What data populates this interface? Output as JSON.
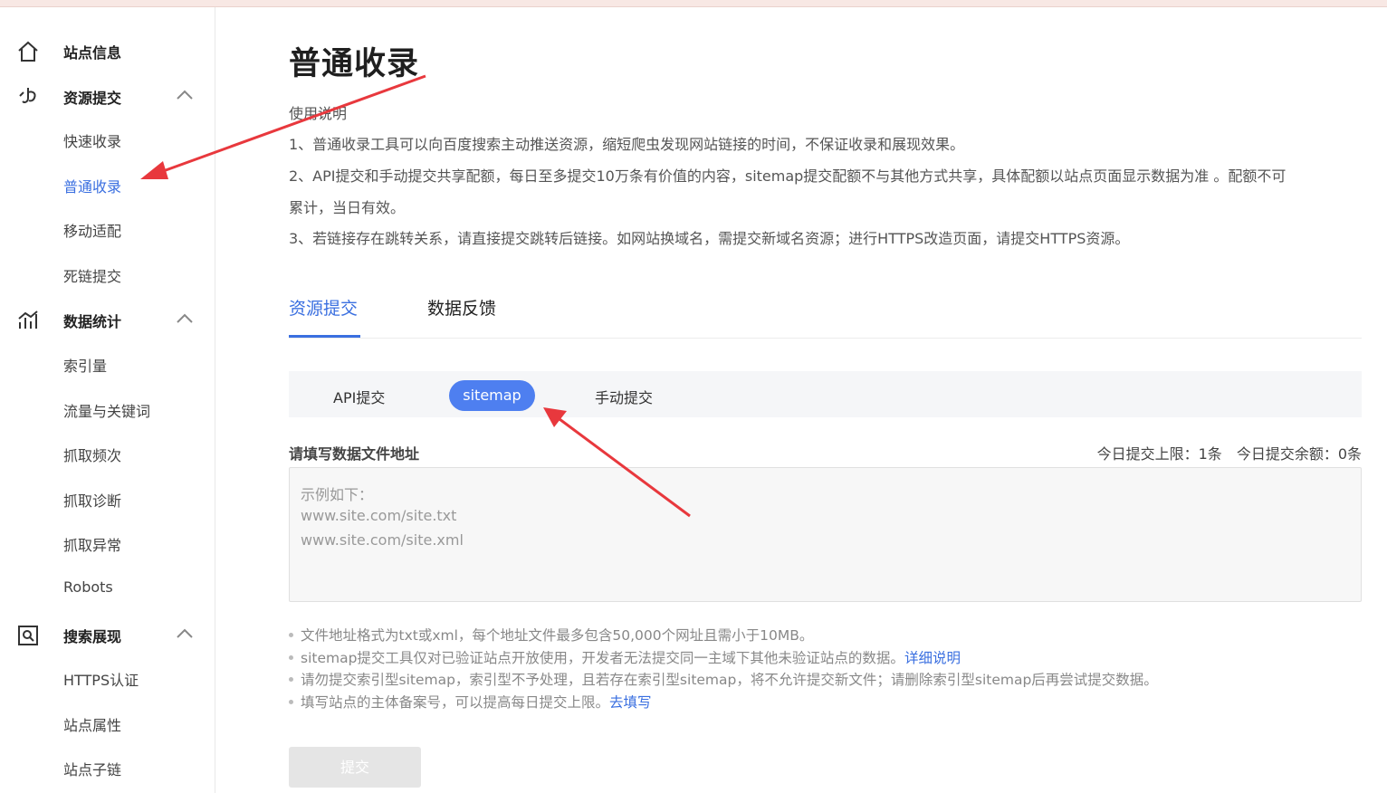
{
  "sidebar": {
    "groups": [
      {
        "label": "站点信息",
        "icon": "home-icon"
      },
      {
        "label": "资源提交",
        "icon": "submit-resource-icon",
        "items": [
          "快速收录",
          "普通收录",
          "移动适配",
          "死链提交"
        ]
      },
      {
        "label": "数据统计",
        "icon": "chart-icon",
        "items": [
          "索引量",
          "流量与关键词",
          "抓取频次",
          "抓取诊断",
          "抓取异常",
          "Robots"
        ]
      },
      {
        "label": "搜索展现",
        "icon": "search-display-icon",
        "items": [
          "HTTPS认证",
          "站点属性",
          "站点子链"
        ]
      }
    ],
    "active_item": "普通收录"
  },
  "page": {
    "title": "普通收录",
    "usage_heading": "使用说明",
    "usage_lines": [
      "1、普通收录工具可以向百度搜索主动推送资源，缩短爬虫发现网站链接的时间，不保证收录和展现效果。",
      "2、API提交和手动提交共享配额，每日至多提交10万条有价值的内容，sitemap提交配额不与其他方式共享，具体配额以站点页面显示数据为准 。配额不可",
      "累计，当日有效。",
      "3、若链接存在跳转关系，请直接提交跳转后链接。如网站换域名，需提交新域名资源；进行HTTPS改造页面，请提交HTTPS资源。"
    ]
  },
  "tabs": {
    "active": "资源提交",
    "other": "数据反馈"
  },
  "subtabs": {
    "api": "API提交",
    "sitemap": "sitemap",
    "manual": "手动提交",
    "active": "sitemap"
  },
  "form": {
    "label": "请填写数据文件地址",
    "quota_limit": "今日提交上限：1条",
    "quota_remaining": "今日提交余额：0条",
    "placeholder_lines": [
      "示例如下：",
      "www.site.com/site.txt",
      "www.site.com/site.xml"
    ]
  },
  "notes": [
    {
      "text": "文件地址格式为txt或xml，每个地址文件最多包含50,000个网址且需小于10MB。",
      "link": ""
    },
    {
      "text": "sitemap提交工具仅对已验证站点开放使用，开发者无法提交同一主域下其他未验证站点的数据。",
      "link": "详细说明"
    },
    {
      "text": "请勿提交索引型sitemap，索引型不予处理，且若存在索引型sitemap，将不允许提交新文件；请删除索引型sitemap后再尝试提交数据。",
      "link": ""
    },
    {
      "text": "填写站点的主体备案号，可以提高每日提交上限。",
      "link": "去填写"
    }
  ],
  "submit_label": "提交",
  "colors": {
    "accent": "#3a6fe0",
    "pill": "#4e7ff0",
    "annotation_arrow": "#e8383d"
  }
}
